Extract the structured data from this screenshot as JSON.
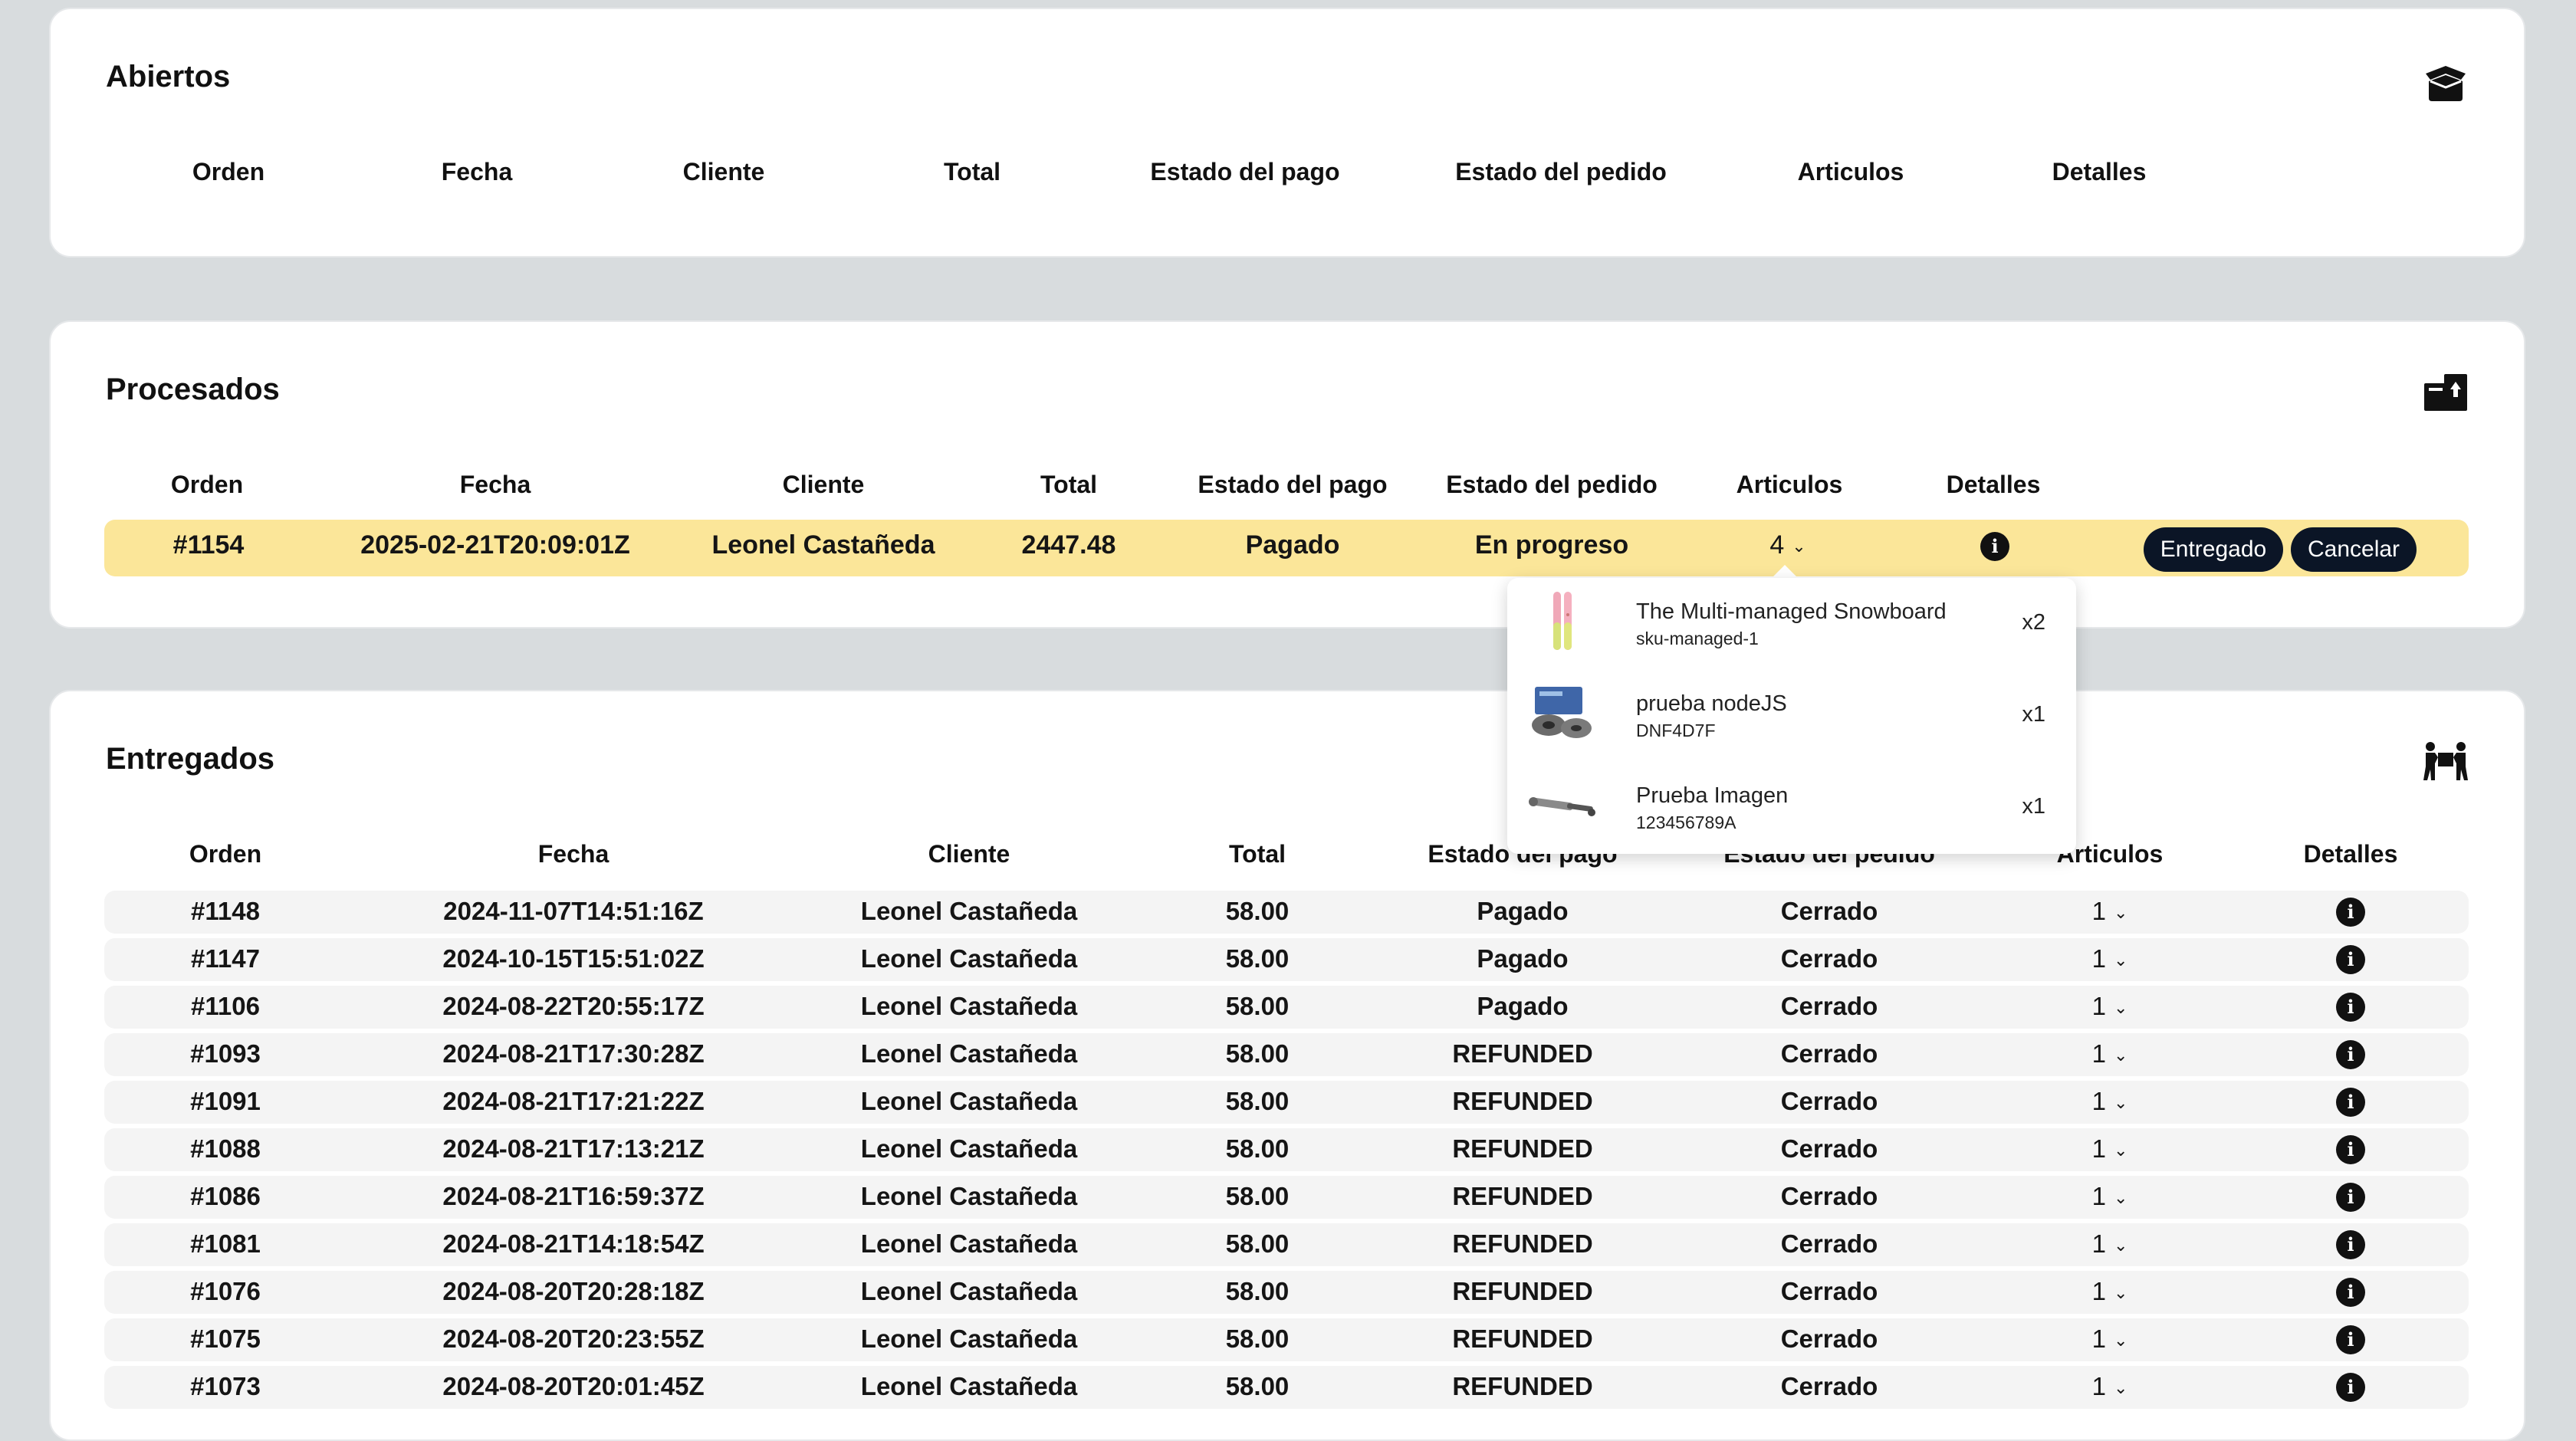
{
  "colors": {
    "background": "#d8dcde",
    "card": "#ffffff",
    "highlight_row": "#fbe699",
    "stripe_row": "#f4f4f4",
    "button": "#0b1526"
  },
  "abiertos": {
    "title": "Abiertos",
    "icon": "open-box-icon",
    "columns": [
      "Orden",
      "Fecha",
      "Cliente",
      "Total",
      "Estado del pago",
      "Estado del pedido",
      "Articulos",
      "Detalles"
    ]
  },
  "procesados": {
    "title": "Procesados",
    "icon": "boxes-upload-icon",
    "columns": [
      "Orden",
      "Fecha",
      "Cliente",
      "Total",
      "Estado del pago",
      "Estado del pedido",
      "Articulos",
      "Detalles"
    ],
    "row": {
      "order": "#1154",
      "date": "2025-02-21T20:09:01Z",
      "client": "Leonel Castañeda",
      "total": "2447.48",
      "payment": "Pagado",
      "status": "En progreso",
      "items": "4"
    },
    "deliver_label": "Entregado",
    "cancel_label": "Cancelar",
    "items_dropdown": [
      {
        "name": "The Multi-managed Snowboard",
        "sku": "sku-managed-1",
        "qty": "x2",
        "thumb": "snowboard"
      },
      {
        "name": "prueba nodeJS",
        "sku": "DNF4D7F",
        "qty": "x1",
        "thumb": "brake-parts"
      },
      {
        "name": "Prueba Imagen",
        "sku": "123456789A",
        "qty": "x1",
        "thumb": "shock-absorber"
      }
    ]
  },
  "entregados": {
    "title": "Entregados",
    "icon": "people-carrying-box-icon",
    "columns": [
      "Orden",
      "Fecha",
      "Cliente",
      "Total",
      "Estado del pago",
      "Estado del pedido",
      "Articulos",
      "Detalles"
    ],
    "rows": [
      {
        "order": "#1148",
        "date": "2024-11-07T14:51:16Z",
        "client": "Leonel Castañeda",
        "total": "58.00",
        "payment": "Pagado",
        "status": "Cerrado",
        "items": "1"
      },
      {
        "order": "#1147",
        "date": "2024-10-15T15:51:02Z",
        "client": "Leonel Castañeda",
        "total": "58.00",
        "payment": "Pagado",
        "status": "Cerrado",
        "items": "1"
      },
      {
        "order": "#1106",
        "date": "2024-08-22T20:55:17Z",
        "client": "Leonel Castañeda",
        "total": "58.00",
        "payment": "Pagado",
        "status": "Cerrado",
        "items": "1"
      },
      {
        "order": "#1093",
        "date": "2024-08-21T17:30:28Z",
        "client": "Leonel Castañeda",
        "total": "58.00",
        "payment": "REFUNDED",
        "status": "Cerrado",
        "items": "1"
      },
      {
        "order": "#1091",
        "date": "2024-08-21T17:21:22Z",
        "client": "Leonel Castañeda",
        "total": "58.00",
        "payment": "REFUNDED",
        "status": "Cerrado",
        "items": "1"
      },
      {
        "order": "#1088",
        "date": "2024-08-21T17:13:21Z",
        "client": "Leonel Castañeda",
        "total": "58.00",
        "payment": "REFUNDED",
        "status": "Cerrado",
        "items": "1"
      },
      {
        "order": "#1086",
        "date": "2024-08-21T16:59:37Z",
        "client": "Leonel Castañeda",
        "total": "58.00",
        "payment": "REFUNDED",
        "status": "Cerrado",
        "items": "1"
      },
      {
        "order": "#1081",
        "date": "2024-08-21T14:18:54Z",
        "client": "Leonel Castañeda",
        "total": "58.00",
        "payment": "REFUNDED",
        "status": "Cerrado",
        "items": "1"
      },
      {
        "order": "#1076",
        "date": "2024-08-20T20:28:18Z",
        "client": "Leonel Castañeda",
        "total": "58.00",
        "payment": "REFUNDED",
        "status": "Cerrado",
        "items": "1"
      },
      {
        "order": "#1075",
        "date": "2024-08-20T20:23:55Z",
        "client": "Leonel Castañeda",
        "total": "58.00",
        "payment": "REFUNDED",
        "status": "Cerrado",
        "items": "1"
      },
      {
        "order": "#1073",
        "date": "2024-08-20T20:01:45Z",
        "client": "Leonel Castañeda",
        "total": "58.00",
        "payment": "REFUNDED",
        "status": "Cerrado",
        "items": "1"
      }
    ]
  }
}
